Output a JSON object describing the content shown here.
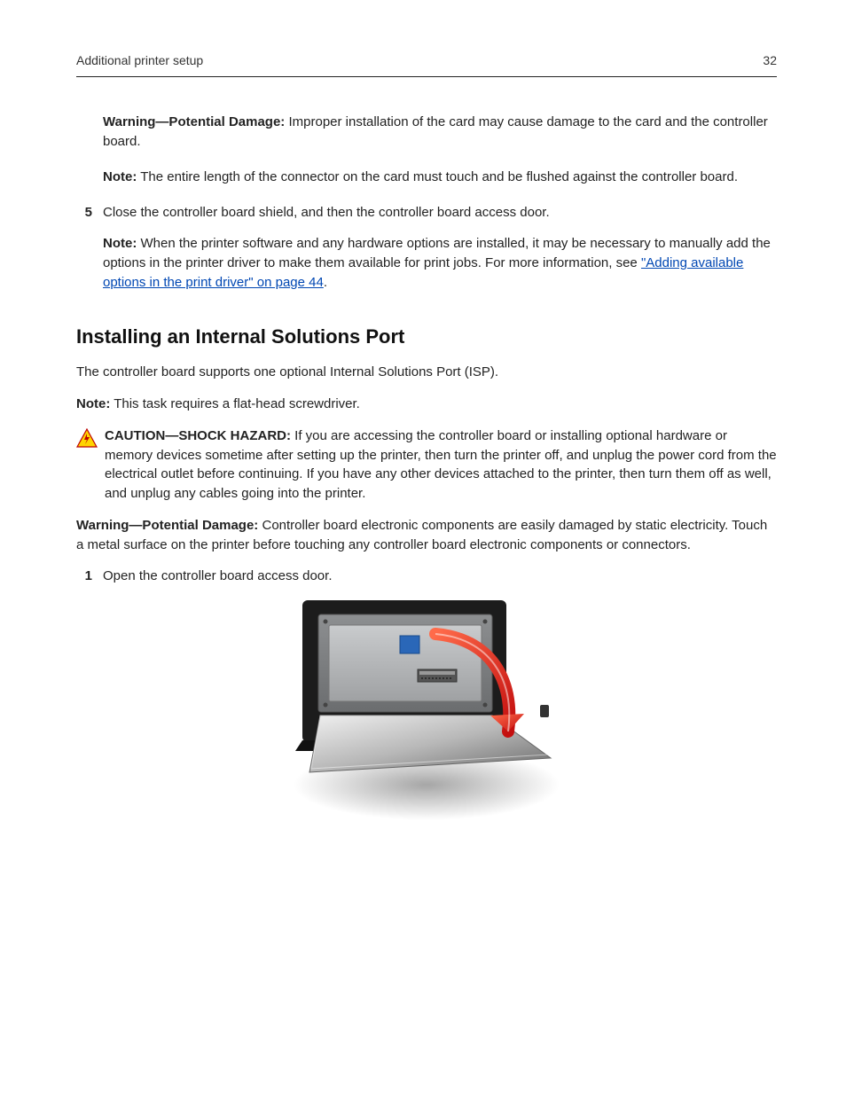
{
  "header": {
    "section": "Additional printer setup",
    "page_number": "32"
  },
  "blocks": {
    "warning1_label": "Warning—Potential Damage:",
    "warning1_text": " Improper installation of the card may cause damage to the card and the controller board.",
    "note1_label": "Note:",
    "note1_text": " The entire length of the connector on the card must touch and be flushed against the controller board.",
    "step5_num": "5",
    "step5_text": "Close the controller board shield, and then the controller board access door.",
    "note2_label": "Note:",
    "note2_text_a": " When the printer software and any hardware options are installed, it may be necessary to manually add the options in the printer driver to make them available for print jobs. For more information, see ",
    "note2_link": "\"Adding available options in the print driver\" on page 44",
    "note2_text_b": ".",
    "heading": "Installing an Internal Solutions Port",
    "intro": "The controller board supports one optional Internal Solutions Port (ISP).",
    "note3_label": "Note:",
    "note3_text": " This task requires a flat-head screwdriver.",
    "caution_label": "CAUTION—SHOCK HAZARD:",
    "caution_text": " If you are accessing the controller board or installing optional hardware or memory devices sometime after setting up the printer, then turn the printer off, and unplug the power cord from the electrical outlet before continuing. If you have any other devices attached to the printer, then turn them off as well, and unplug any cables going into the printer.",
    "warning2_label": "Warning—Potential Damage:",
    "warning2_text": " Controller board electronic components are easily damaged by static electricity. Touch a metal surface on the printer before touching any controller board electronic components or connectors.",
    "step1_num": "1",
    "step1_text": "Open the controller board access door."
  }
}
